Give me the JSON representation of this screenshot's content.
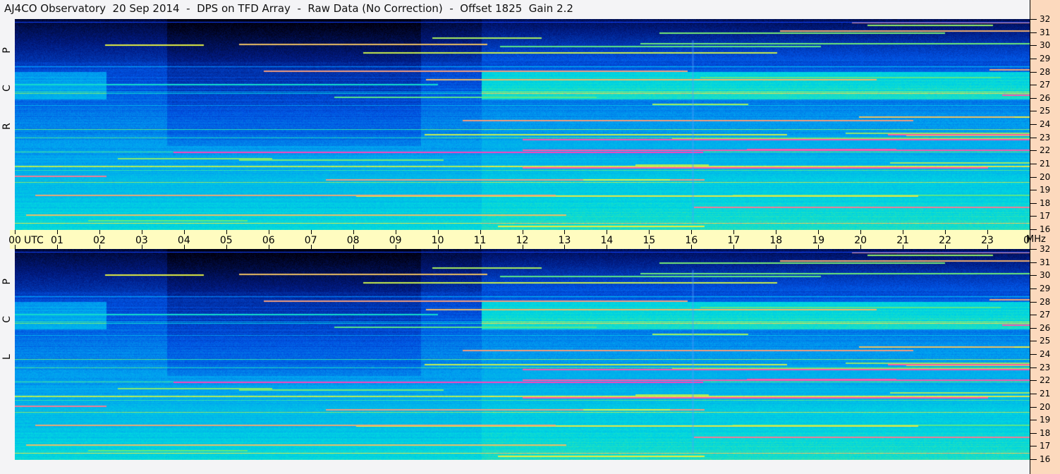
{
  "title": "AJ4CO Observatory  20 Sep 2014  -  DPS on TFD Array  -  Raw Data (No Correction)  -  Offset 1825  Gain 2.2",
  "chart_data": {
    "type": "heatmap",
    "title": "AJ4CO Observatory  20 Sep 2014  -  DPS on TFD Array  -  Raw Data (No Correction)  -  Offset 1825  Gain 2.2",
    "xlabel": "UTC",
    "ylabel": "MHz",
    "x_ticks": [
      "00",
      "01",
      "02",
      "03",
      "04",
      "05",
      "06",
      "07",
      "08",
      "09",
      "10",
      "11",
      "12",
      "13",
      "14",
      "15",
      "16",
      "17",
      "18",
      "19",
      "20",
      "21",
      "22",
      "23",
      "00"
    ],
    "y_ticks": [
      "32",
      "31",
      "30",
      "29",
      "28",
      "27",
      "26",
      "25",
      "24",
      "23",
      "22",
      "21",
      "20",
      "19",
      "18",
      "17",
      "16"
    ],
    "xlim": [
      0,
      24
    ],
    "ylim": [
      16,
      32
    ],
    "panels": [
      {
        "name": "RCP",
        "label": "R C P"
      },
      {
        "name": "LCP",
        "label": "L C P"
      }
    ],
    "colormap": [
      "#000010",
      "#001a80",
      "#0050e0",
      "#00a0f0",
      "#00d8e0",
      "#60e880",
      "#e8f040",
      "#ff40c0"
    ]
  }
}
